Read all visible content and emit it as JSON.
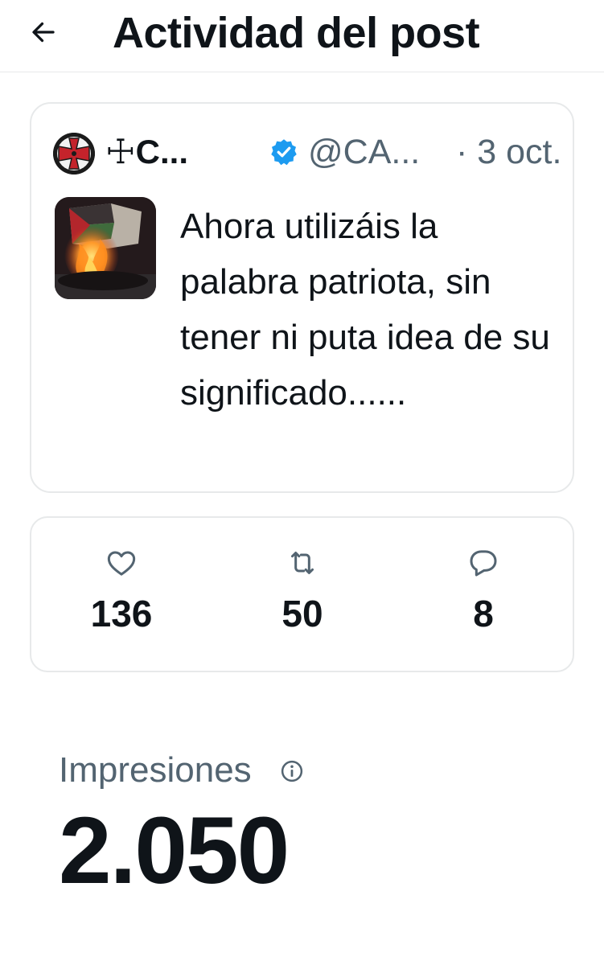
{
  "header": {
    "title": "Actividad del post",
    "back_icon": "arrow-left-icon"
  },
  "post": {
    "author_name": "☩C...",
    "author_handle": "@CA...",
    "date": "· 3 oct.",
    "verified": true,
    "text": "Ahora utilizáis la palabra patriota, sin tener ni puta idea de su significado......",
    "accent_color": "#1d9bf0"
  },
  "metrics": {
    "likes": {
      "icon": "heart-icon",
      "value": "136"
    },
    "reposts": {
      "icon": "repost-icon",
      "value": "50"
    },
    "replies": {
      "icon": "reply-bubble-icon",
      "value": "8"
    }
  },
  "impressions": {
    "label": "Impresiones",
    "info_icon": "info-icon",
    "value": "2.050"
  }
}
